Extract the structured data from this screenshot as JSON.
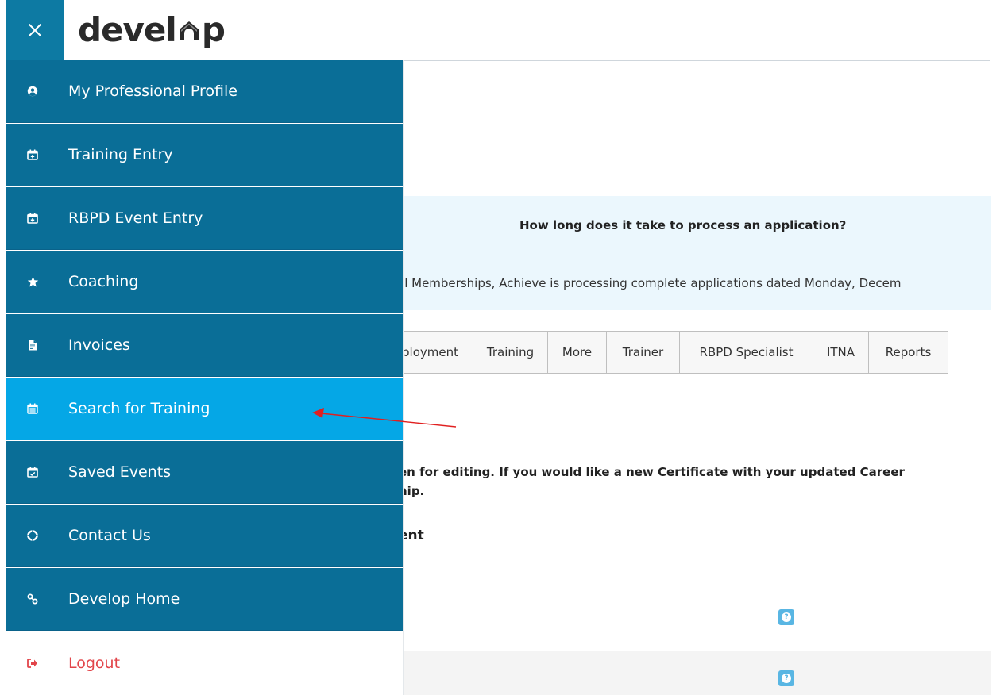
{
  "header": {
    "logo_text_before": "devel",
    "logo_text_after": "p"
  },
  "sidebar": {
    "items": [
      {
        "label": "My Professional Profile",
        "icon": "user-circle-icon"
      },
      {
        "label": "Training Entry",
        "icon": "calendar-plus-icon"
      },
      {
        "label": "RBPD Event Entry",
        "icon": "calendar-plus-icon"
      },
      {
        "label": "Coaching",
        "icon": "star-icon"
      },
      {
        "label": "Invoices",
        "icon": "document-icon"
      },
      {
        "label": "Search for Training",
        "icon": "calendar-grid-icon",
        "active": true
      },
      {
        "label": "Saved Events",
        "icon": "calendar-check-icon"
      },
      {
        "label": "Contact Us",
        "icon": "lifebuoy-icon"
      },
      {
        "label": "Develop Home",
        "icon": "link-icon"
      },
      {
        "label": "Logout",
        "icon": "sign-out-icon"
      }
    ]
  },
  "main": {
    "faq_question": "How long does it take to process an application?",
    "faq_answer": "al Memberships, Achieve is processing complete applications dated Monday, Decem",
    "tabs": [
      "ployment",
      "Training",
      "More",
      "Trainer",
      "RBPD Specialist",
      "ITNA",
      "Reports"
    ],
    "notice_line1": "en for editing. If you would like a new Certificate with your updated Career",
    "notice_line2": "hip.",
    "section_heading": "ent"
  },
  "colors": {
    "sidebar_bg": "#0a6e97",
    "sidebar_active": "#05a7e6",
    "logout_text": "#e2454a",
    "banner_bg": "#ebf7fd",
    "help_icon": "#59b6e3",
    "annotation_arrow": "#e02020"
  }
}
